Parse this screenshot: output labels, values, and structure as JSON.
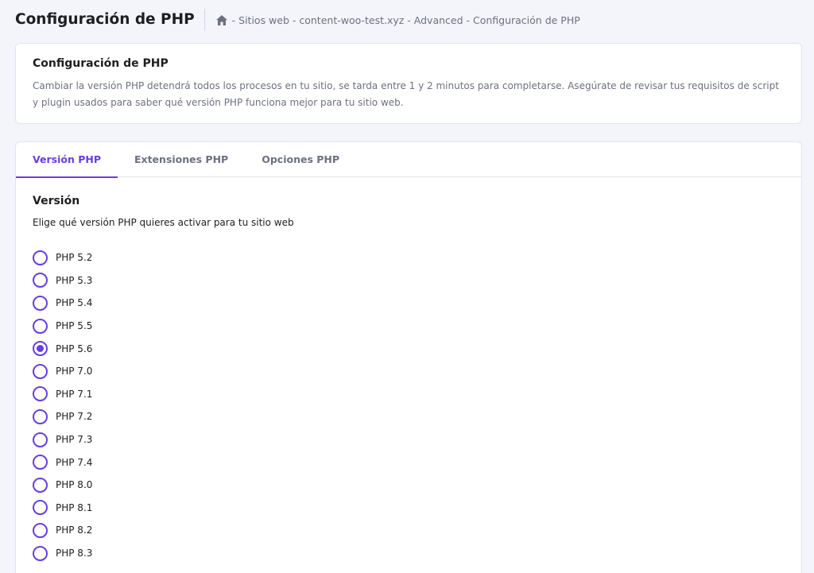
{
  "header": {
    "title": "Configuración de PHP",
    "breadcrumb": "- Sitios web - content-woo-test.xyz - Advanced - Configuración de PHP"
  },
  "info": {
    "title": "Configuración de PHP",
    "text": "Cambiar la versión PHP detendrá todos los procesos en tu sitio, se tarda entre 1 y 2 minutos para completarse. Asegúrate de revisar tus requisitos de script y plugin usados para saber qué versión PHP funciona mejor para tu sitio web."
  },
  "tabs": [
    {
      "label": "Versión PHP",
      "active": true
    },
    {
      "label": "Extensiones PHP",
      "active": false
    },
    {
      "label": "Opciones PHP",
      "active": false
    }
  ],
  "version": {
    "title": "Versión",
    "description": "Elige qué versión PHP quieres activar para tu sitio web",
    "selected": "PHP 5.6",
    "options": [
      "PHP 5.2",
      "PHP 5.3",
      "PHP 5.4",
      "PHP 5.5",
      "PHP 5.6",
      "PHP 7.0",
      "PHP 7.1",
      "PHP 7.2",
      "PHP 7.3",
      "PHP 7.4",
      "PHP 8.0",
      "PHP 8.1",
      "PHP 8.2",
      "PHP 8.3"
    ]
  },
  "colors": {
    "accent": "#673de6",
    "background": "#f4f4fb",
    "text_muted": "#6d7081"
  },
  "icons": {
    "home": "home-icon"
  }
}
